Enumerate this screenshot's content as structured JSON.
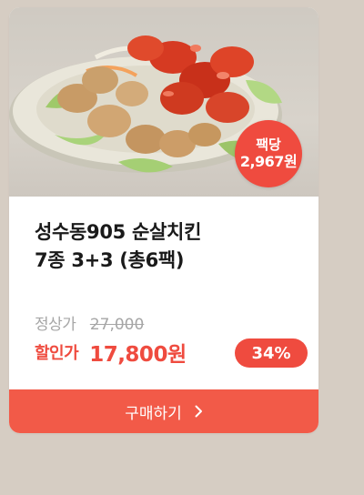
{
  "product": {
    "image_alt_icon": "fried-chicken-plate",
    "badge": {
      "line1": "팩당",
      "line2": "2,967원"
    },
    "title_line1": "성수동905 순살치킨",
    "title_line2": "7종 3+3 (총6팩)",
    "regular_label": "정상가",
    "regular_price": "27,000",
    "sale_label": "할인가",
    "sale_price": "17,800원",
    "discount": "34%",
    "buy_label": "구매하기",
    "buy_icon": "chevron-right-icon"
  },
  "colors": {
    "accent": "#ef4b3f",
    "button": "#f25a48",
    "background": "#d6cdc3"
  }
}
